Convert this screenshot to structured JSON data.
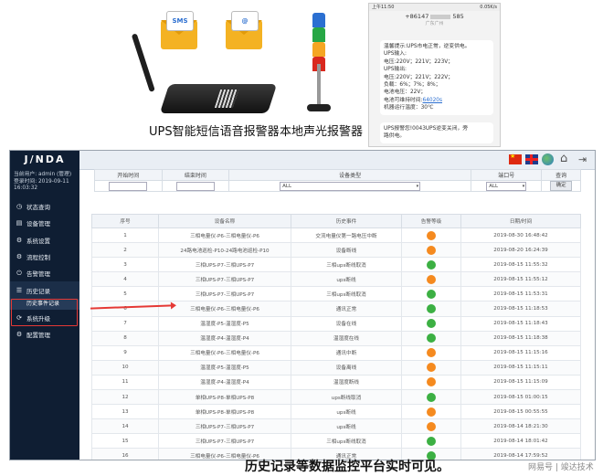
{
  "promo": {
    "label_1": "UPS智能短信语音报警器",
    "label_2": "本地声光报警器",
    "env_sms": "SMS",
    "env_mail": "@",
    "beacon_colors": [
      "#2b6fd1",
      "#27a745",
      "#f5a623",
      "#d9281e"
    ]
  },
  "phone": {
    "status_time": "上午11:50",
    "status_right": "0.05K/s",
    "title": "+86147",
    "title_tail": "585",
    "subtitle": "广东广州",
    "msg1": [
      "温馨提示:UPS市电正常，逆变供电。",
      "UPS输入:",
      "电压:220V；221V；223V；",
      "UPS输出:",
      "电压:220V；221V；222V；",
      "负载：6%；7%；8%；",
      "电池电压：22V；",
      "电池可维持时间:",
      "机器运行温度：30℃"
    ],
    "msg1_link": "64020s",
    "msg2": [
      "UPS报警您!0043UPS逆变关闭，旁",
      "路供电。"
    ]
  },
  "app": {
    "brand": "J/NDA",
    "user_line1": "当前用户: admin (管理)",
    "user_line2": "登录时间: 2019-09-11",
    "user_line3": "16:03:32",
    "menu": [
      {
        "icon": "◷",
        "label": "状态查询"
      },
      {
        "icon": "▤",
        "label": "设备管理"
      },
      {
        "icon": "⚙",
        "label": "系统设置"
      },
      {
        "icon": "⚙",
        "label": "流程控制"
      },
      {
        "icon": "⏻",
        "label": "告警管理"
      },
      {
        "icon": "☰",
        "label": "历史记录"
      },
      {
        "icon": "⟳",
        "label": "系统升级"
      },
      {
        "icon": "⚙",
        "label": "配置管理"
      }
    ],
    "submenu_label": "历史事件记录",
    "filter": {
      "start_time": "开始时间",
      "end_time": "结束时间",
      "device_type": "设备类型",
      "port": "端口号",
      "query": "查询",
      "device_value": "ALL",
      "port_value": "ALL",
      "confirm": "确定"
    },
    "table": {
      "headers": [
        "序号",
        "设备名称",
        "历史事件",
        "告警等级",
        "日期/时间"
      ],
      "rows": [
        {
          "no": "1",
          "name": "三相电量仪-P6-三相电量仪-P6",
          "event": "交流电量仪第一路电压中断",
          "level": "orange",
          "time": "2019-08-30 16:48:42"
        },
        {
          "no": "2",
          "name": "24路电池巡检-P10-24路电池巡检-P10",
          "event": "设备断线",
          "level": "orange",
          "time": "2019-08-20 16:24:39"
        },
        {
          "no": "3",
          "name": "三相UPS-P7-三相UPS-P7",
          "event": "三相ups断线取消",
          "level": "green",
          "time": "2019-08-15 11:55:32"
        },
        {
          "no": "4",
          "name": "三相UPS-P7-三相UPS-P7",
          "event": "ups断线",
          "level": "orange",
          "time": "2019-08-15 11:55:12"
        },
        {
          "no": "5",
          "name": "三相UPS-P7-三相UPS-P7",
          "event": "三相ups断线取消",
          "level": "green",
          "time": "2019-08-15 11:53:31"
        },
        {
          "no": "6",
          "name": "三相电量仪-P6-三相电量仪-P6",
          "event": "通讯正常",
          "level": "green",
          "time": "2019-08-15 11:18:53"
        },
        {
          "no": "7",
          "name": "温湿度-P5-温湿度-P5",
          "event": "设备在线",
          "level": "green",
          "time": "2019-08-15 11:18:43"
        },
        {
          "no": "8",
          "name": "温湿度-P4-温湿度-P4",
          "event": "温湿度在线",
          "level": "green",
          "time": "2019-08-15 11:18:38"
        },
        {
          "no": "9",
          "name": "三相电量仪-P6-三相电量仪-P6",
          "event": "通讯中断",
          "level": "orange",
          "time": "2019-08-15 11:15:16"
        },
        {
          "no": "10",
          "name": "温湿度-P5-温湿度-P5",
          "event": "设备离线",
          "level": "orange",
          "time": "2019-08-15 11:15:11"
        },
        {
          "no": "11",
          "name": "温湿度-P4-温湿度-P4",
          "event": "温湿度断线",
          "level": "orange",
          "time": "2019-08-15 11:15:09"
        },
        {
          "no": "12",
          "name": "单相UPS-P8-单相UPS-P8",
          "event": "ups断线取消",
          "level": "green",
          "time": "2019-08-15 01:00:15"
        },
        {
          "no": "13",
          "name": "单相UPS-P8-单相UPS-P8",
          "event": "ups断线",
          "level": "orange",
          "time": "2019-08-15 00:55:55"
        },
        {
          "no": "14",
          "name": "三相UPS-P7-三相UPS-P7",
          "event": "ups断线",
          "level": "orange",
          "time": "2019-08-14 18:21:30"
        },
        {
          "no": "15",
          "name": "三相UPS-P7-三相UPS-P7",
          "event": "三相ups断线取消",
          "level": "green",
          "time": "2019-08-14 18:01:42"
        },
        {
          "no": "16",
          "name": "三相电量仪-P6-三相电量仪-P6",
          "event": "通讯正常",
          "level": "green",
          "time": "2019-08-14 17:59:52"
        },
        {
          "no": "17",
          "name": "温湿度-P5-温湿度-P5",
          "event": "设备在线",
          "level": "green",
          "time": "2019-08-14 17:59:42"
        }
      ]
    }
  },
  "level_colors": {
    "orange": "#f58a1f",
    "green": "#3cb043"
  },
  "caption": "历史记录等数据监控平台实时可见。",
  "watermark": "网易号 | 竣达技术"
}
